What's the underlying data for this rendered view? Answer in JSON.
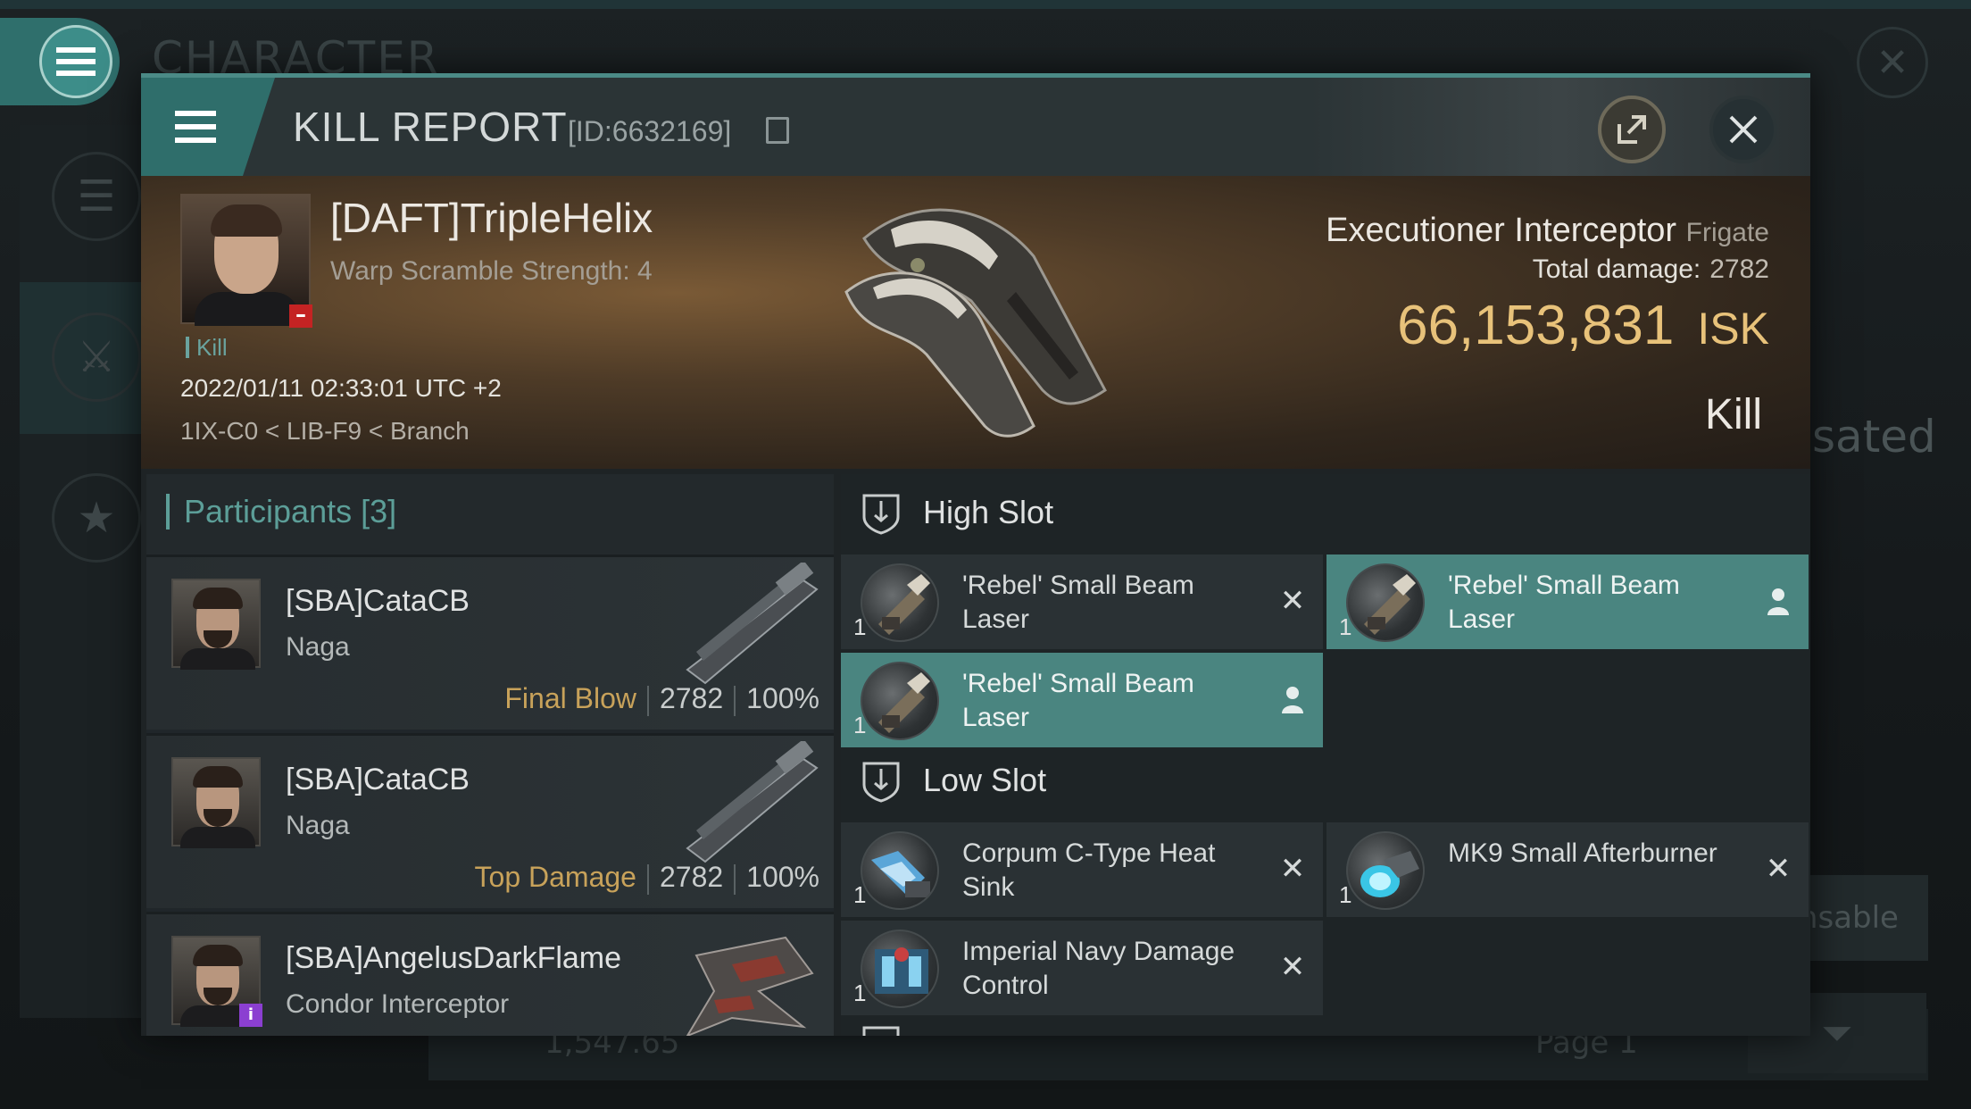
{
  "background": {
    "title": "CHARACTER",
    "right_text": "sated",
    "right_button": "ensable",
    "footer_value": "1,547.65",
    "footer_page": "Page 1"
  },
  "header": {
    "title": "KILL REPORT",
    "report_id": "[ID:6632169]"
  },
  "victim": {
    "name": "[DAFT]TripleHelix",
    "warp_scramble": "Warp Scramble Strength: 4",
    "tag": "Kill",
    "timestamp": "2022/01/11 02:33:01 UTC +2",
    "location": "1IX-C0 < LIB-F9 < Branch",
    "ship_name": "Executioner Interceptor",
    "ship_class": "Frigate",
    "total_damage_label": "Total damage:",
    "total_damage": "2782",
    "isk_value": "66,153,831",
    "isk_unit": "ISK",
    "result": "Kill"
  },
  "participants": {
    "title": "Participants [3]",
    "rows": [
      {
        "name": "[SBA]CataCB",
        "ship": "Naga",
        "role": "Final Blow",
        "damage": "2782",
        "percent": "100%"
      },
      {
        "name": "[SBA]CataCB",
        "ship": "Naga",
        "role": "Top Damage",
        "damage": "2782",
        "percent": "100%"
      },
      {
        "name": "[SBA]AngelusDarkFlame",
        "ship": "Condor Interceptor"
      }
    ]
  },
  "slots": {
    "high": {
      "label": "High Slot",
      "items": [
        {
          "qty": "1",
          "name": "'Rebel' Small Beam Laser",
          "status": "destroyed"
        },
        {
          "qty": "1",
          "name": "'Rebel' Small Beam Laser",
          "status": "dropped"
        },
        {
          "qty": "1",
          "name": "'Rebel' Small Beam Laser",
          "status": "dropped"
        }
      ]
    },
    "low": {
      "label": "Low Slot",
      "items": [
        {
          "qty": "1",
          "name": "Corpum C-Type Heat Sink",
          "status": "destroyed"
        },
        {
          "qty": "1",
          "name": "MK9 Small Afterburner",
          "status": "destroyed"
        },
        {
          "qty": "1",
          "name": "Imperial Navy Damage Control",
          "status": "destroyed"
        }
      ]
    }
  },
  "colors": {
    "accent": "#4a8580",
    "isk": "#e8c27a",
    "final_blow": "#c8a25a"
  }
}
